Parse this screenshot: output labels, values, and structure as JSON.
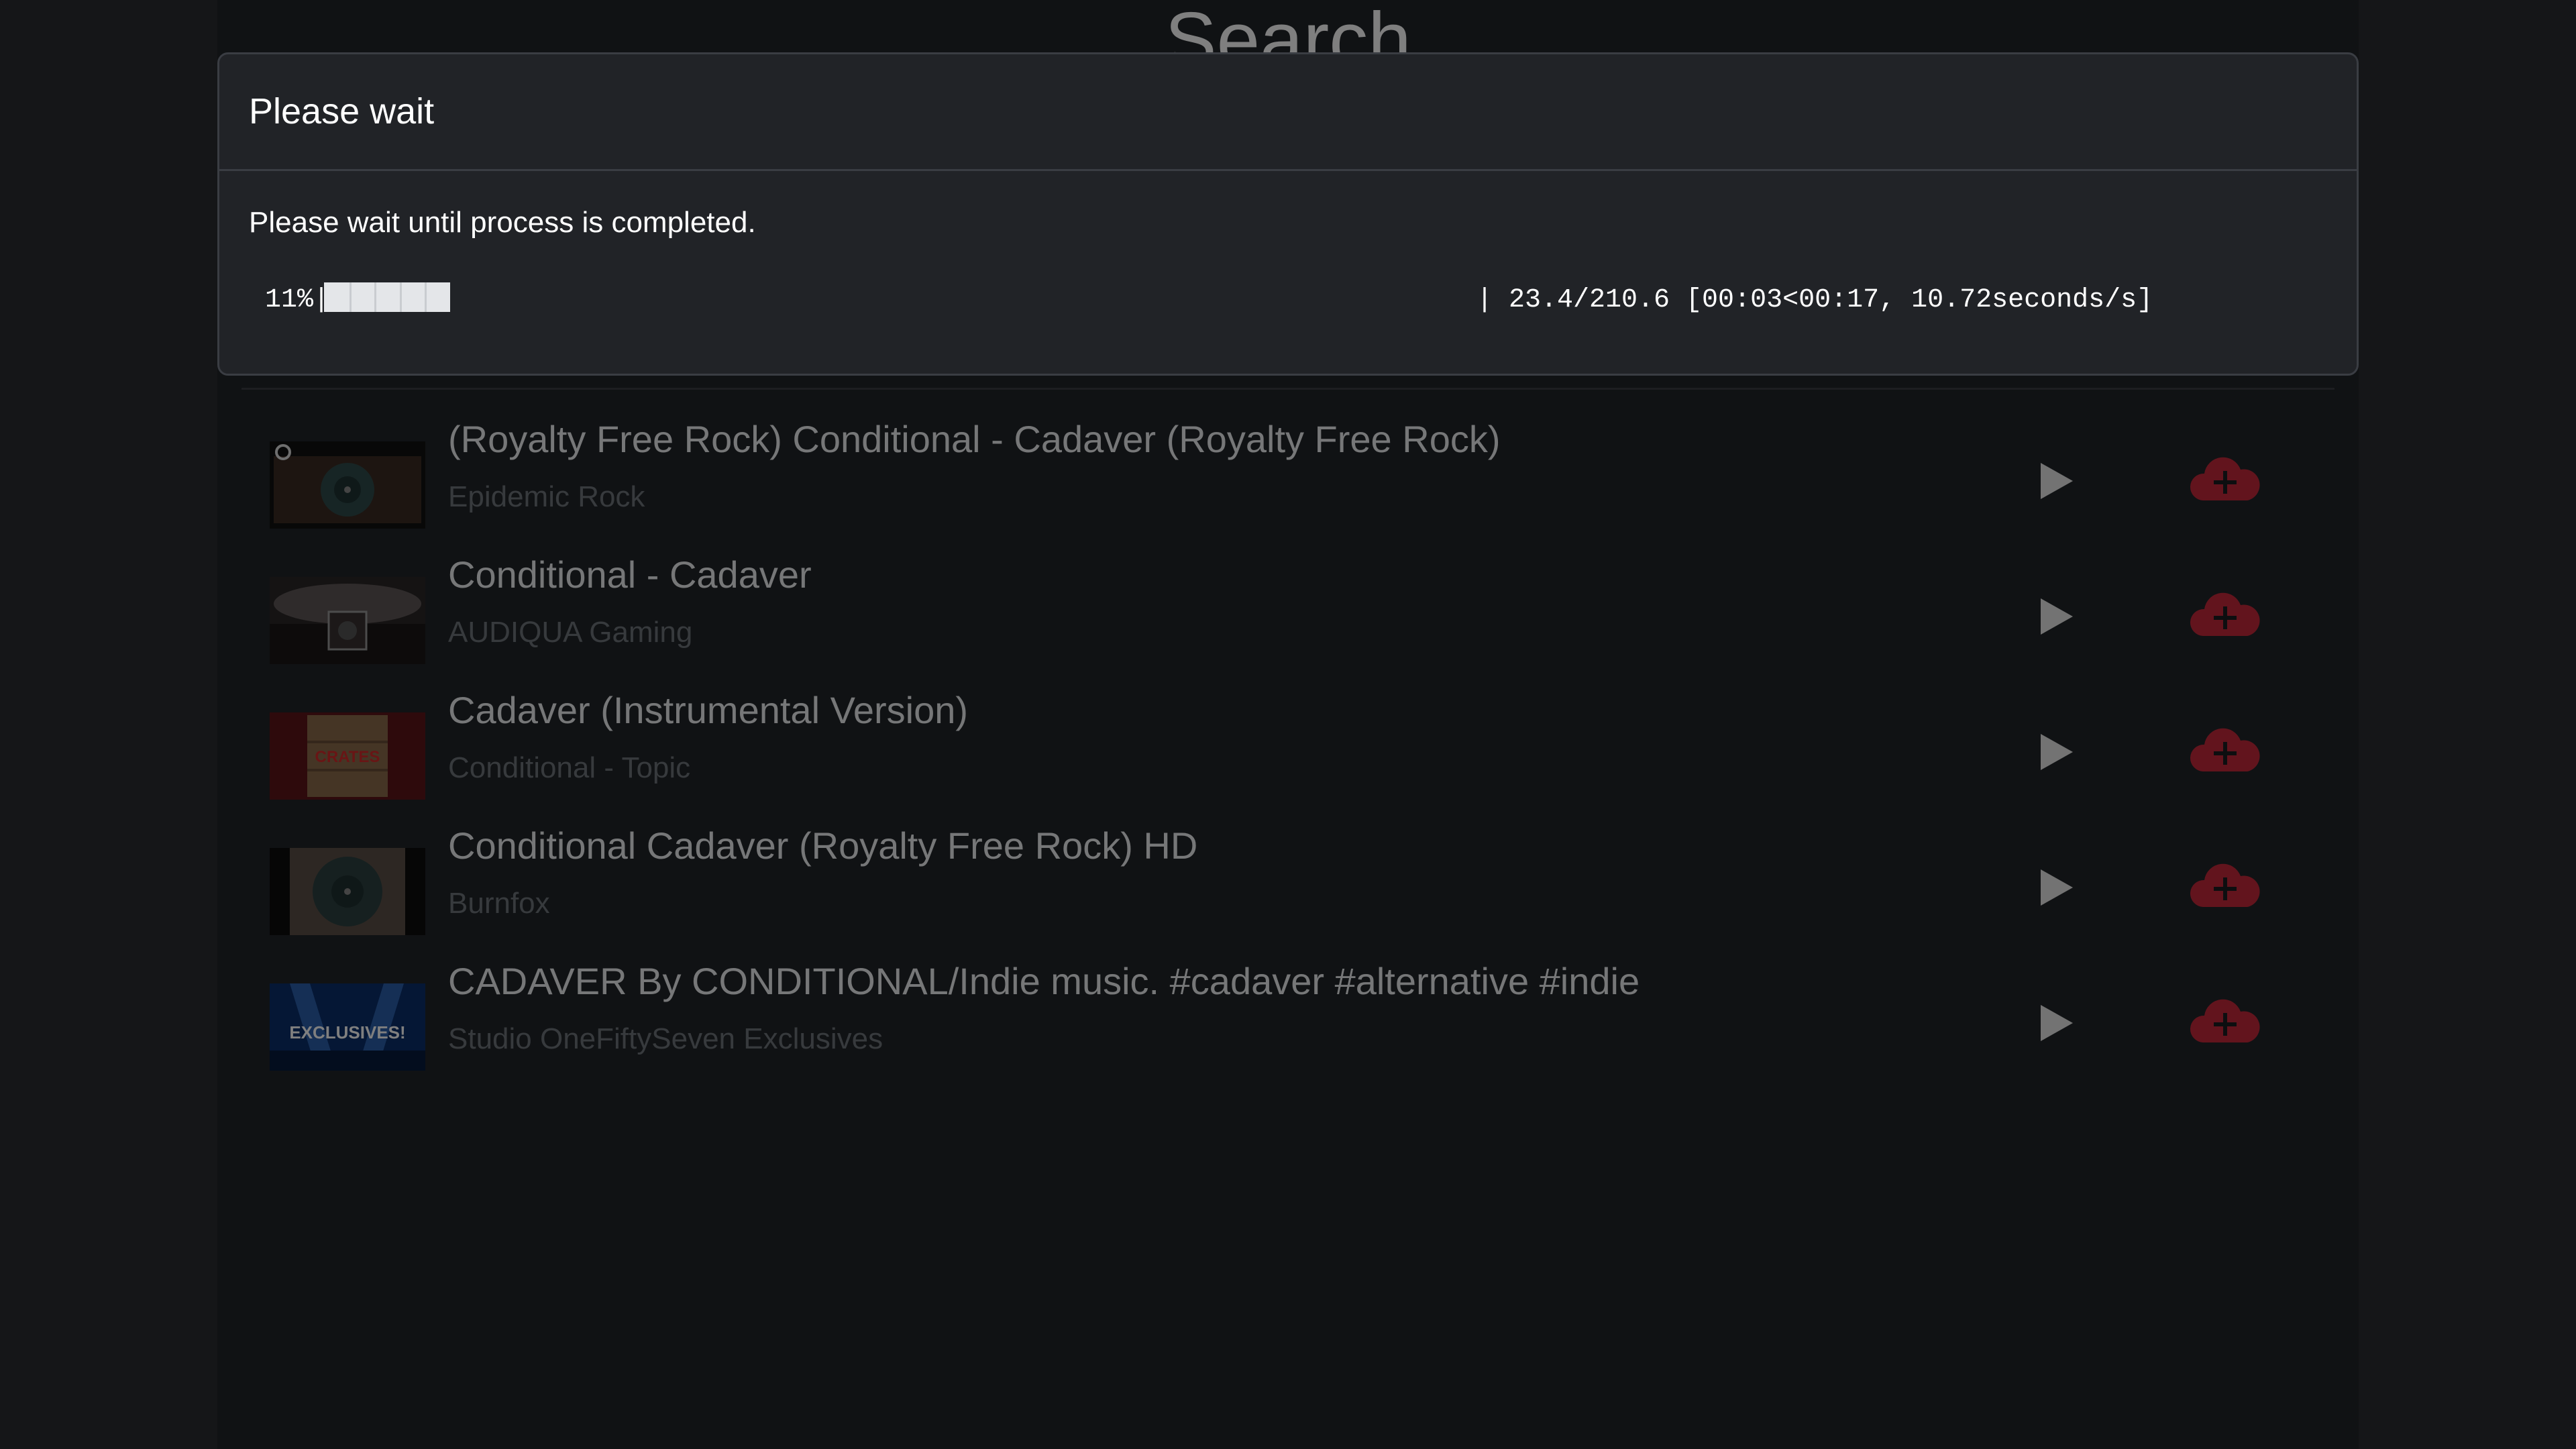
{
  "page": {
    "heading": "Search"
  },
  "results": [
    {
      "title": "(Royalty Free Rock) Conditional - Cadaver (Royalty Free Rock)",
      "channel": "Epidemic Rock",
      "thumb_icon": "vinyl-record-thumbnail"
    },
    {
      "title": "Conditional - Cadaver",
      "channel": "AUDIQUA Gaming",
      "thumb_icon": "record-player-thumbnail"
    },
    {
      "title": "Cadaver (Instrumental Version)",
      "channel": "Conditional - Topic",
      "thumb_icon": "wooden-crate-thumbnail"
    },
    {
      "title": "Conditional Cadaver (Royalty Free Rock) HD",
      "channel": "Burnfox",
      "thumb_icon": "vinyl-record-thumbnail"
    },
    {
      "title": "CADAVER By CONDITIONAL/Indie music. #cadaver #alternative #indie",
      "channel": "Studio OneFiftySeven Exclusives",
      "thumb_icon": "exclusives-stage-thumbnail"
    }
  ],
  "result_actions": {
    "play_icon": "play-icon",
    "download_icon": "cloud-plus-icon",
    "download_color": "#c5293a",
    "play_color": "#e6e6e6"
  },
  "modal": {
    "title": "Please wait",
    "message": "Please wait until process is completed.",
    "progress": {
      "percent_label": "11%|",
      "fraction": 0.11,
      "stats": "| 23.4/210.6 [00:03<00:17, 10.72seconds/s]"
    }
  },
  "thumbnail_text": {
    "crates": "CRATES",
    "exclusives": "EXCLUSIVES!"
  },
  "colors": {
    "background": "#2b2d31",
    "column": "#212428",
    "modal": "#212327",
    "backdrop": "rgba(0,0,0,0.5)"
  }
}
